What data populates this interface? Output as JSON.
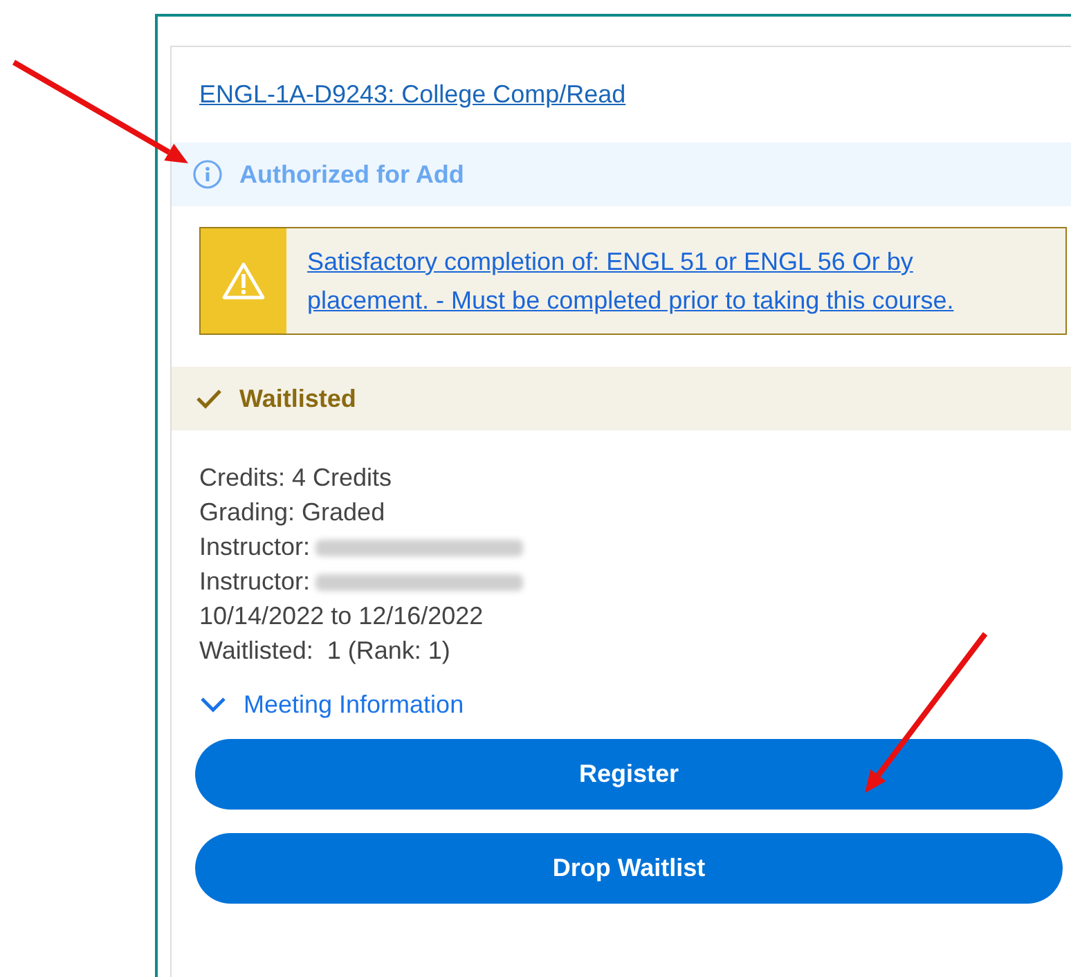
{
  "course": {
    "title": "ENGL-1A-D9243: College Comp/Read",
    "authorization": {
      "label": "Authorized for Add"
    },
    "requisite": {
      "text": "Satisfactory completion of: ENGL 51 or ENGL 56 Or by placement. - Must be completed prior to taking this course."
    },
    "status": {
      "label": "Waitlisted"
    },
    "details": [
      {
        "kind": "text",
        "text": "Credits: 4 Credits"
      },
      {
        "kind": "text",
        "text": "Grading: Graded"
      },
      {
        "kind": "redacted",
        "text": "Instructor:"
      },
      {
        "kind": "redacted",
        "text": "Instructor:"
      },
      {
        "kind": "text",
        "text": "10/14/2022 to 12/16/2022"
      },
      {
        "kind": "text",
        "text": "Waitlisted:  1 (Rank: 1)"
      }
    ],
    "meeting_info": {
      "label": "Meeting Information",
      "expanded": false
    },
    "buttons": [
      "Register",
      "Drop Waitlist"
    ]
  }
}
